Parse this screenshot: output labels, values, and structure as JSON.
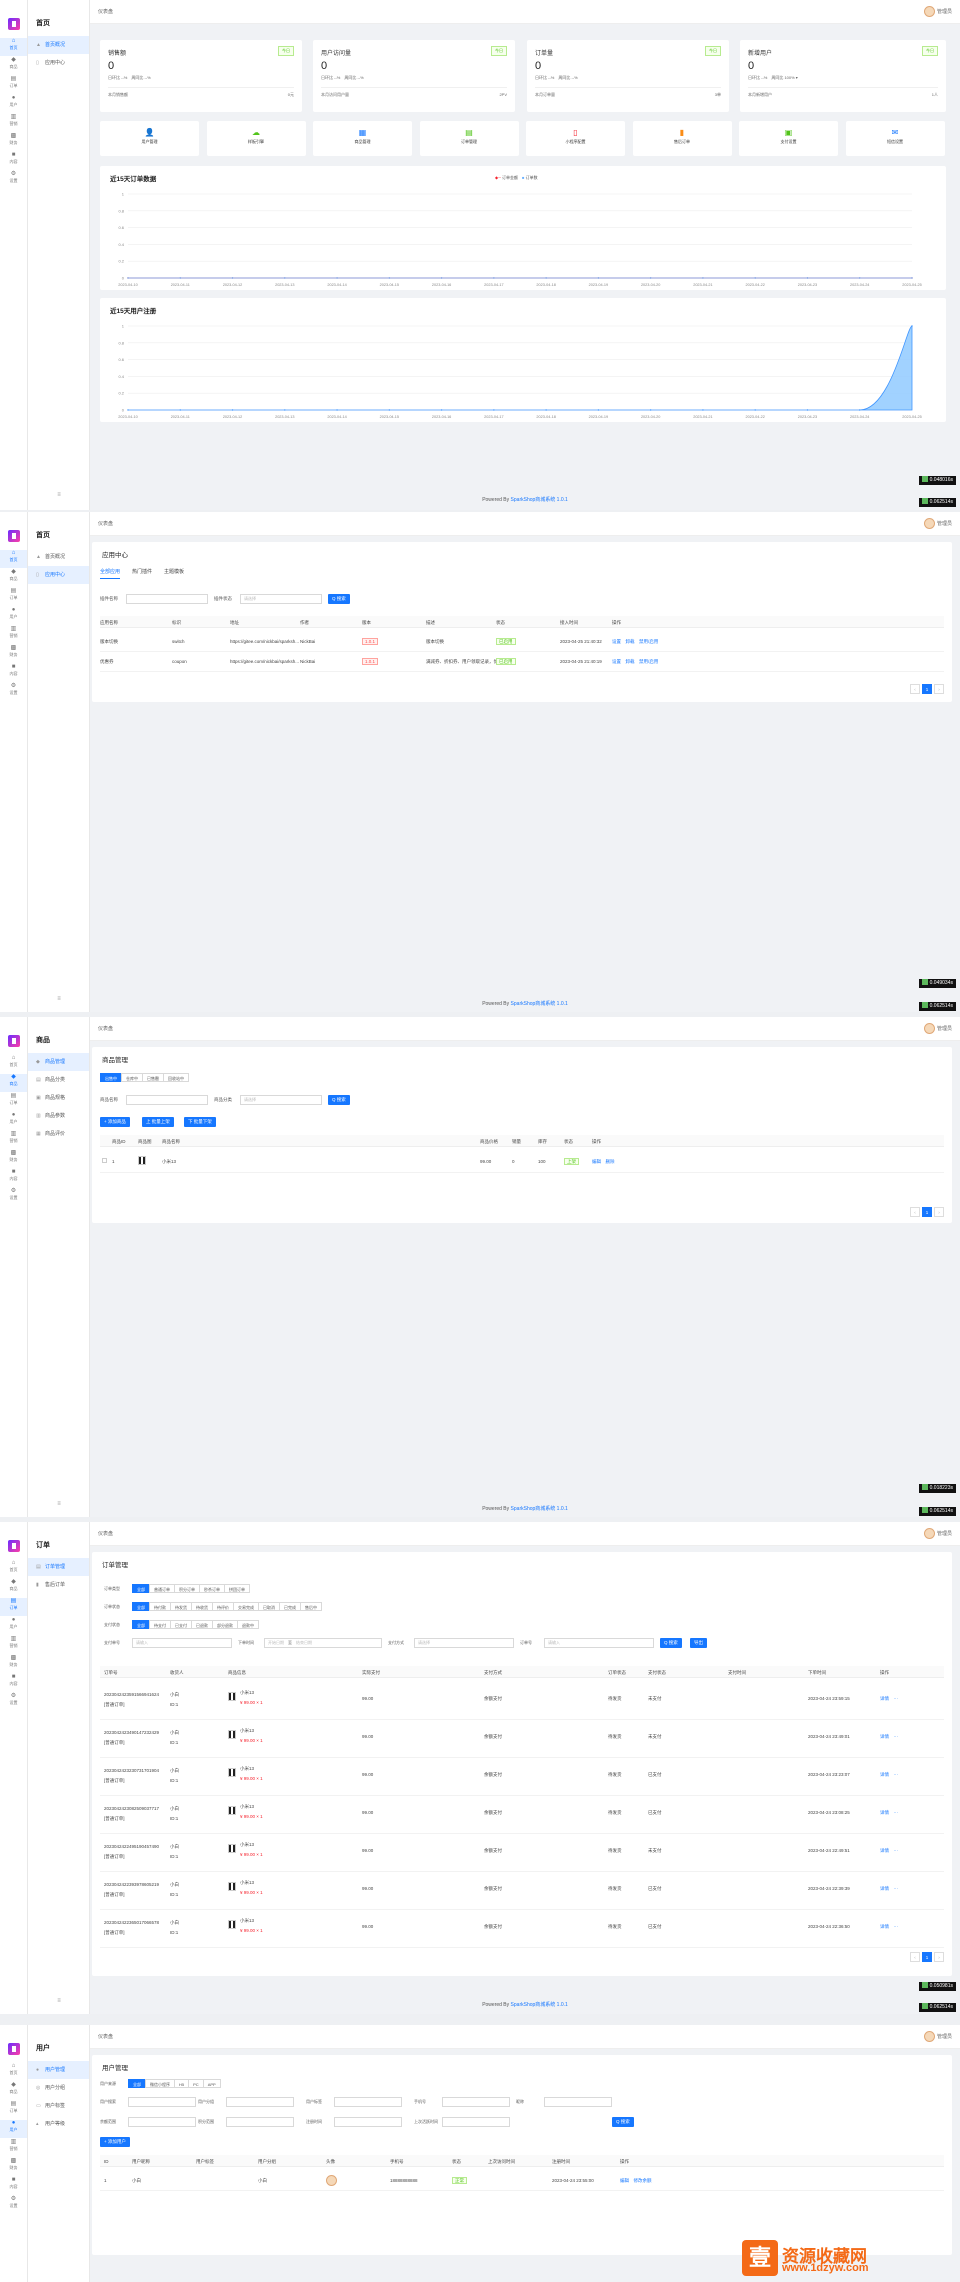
{
  "common": {
    "admin": "管理员",
    "breadcrumb": "仪表盘",
    "fold": "≡",
    "footer_prefix": "Powered By ",
    "footer_link": "SparkShop商城系统 1.0.1",
    "rail": [
      {
        "icon": "⌂",
        "label": "首页"
      },
      {
        "icon": "◆",
        "label": "商品"
      },
      {
        "icon": "▤",
        "label": "订单"
      },
      {
        "icon": "●",
        "label": "用户"
      },
      {
        "icon": "▥",
        "label": "营销"
      },
      {
        "icon": "▩",
        "label": "财务"
      },
      {
        "icon": "■",
        "label": "内容"
      },
      {
        "icon": "⚙",
        "label": "设置"
      }
    ]
  },
  "s1": {
    "sub_title": "首页",
    "menu": [
      "首页概况",
      "应用中心"
    ],
    "stats": [
      {
        "title": "销售额",
        "tag": "今日",
        "value": "0",
        "cmp": "日环比 --%　周同比 --%",
        "foot": "本月销售额",
        "foot_val": "0元"
      },
      {
        "title": "用户访问量",
        "tag": "今日",
        "value": "0",
        "cmp": "日环比 --%　周同比 --%",
        "foot": "本月访问用户量",
        "foot_val": "2PV"
      },
      {
        "title": "订单量",
        "tag": "今日",
        "value": "0",
        "cmp": "日环比 --%　周同比 --%",
        "foot": "本月订单量",
        "foot_val": "3单"
      },
      {
        "title": "新增用户",
        "tag": "今日",
        "value": "0",
        "cmp": "日环比 --%　周同比 100% ▾",
        "foot": "本月新增用户",
        "foot_val": "1人"
      }
    ],
    "quick": [
      {
        "icon": "👤",
        "label": "用户管理",
        "color": "#1677ff"
      },
      {
        "icon": "☁",
        "label": "样板引擎",
        "color": "#52c41a"
      },
      {
        "icon": "▦",
        "label": "商品管理",
        "color": "#1677ff"
      },
      {
        "icon": "▤",
        "label": "订单管理",
        "color": "#52c41a"
      },
      {
        "icon": "▯",
        "label": "小程序配置",
        "color": "#f5222d"
      },
      {
        "icon": "▮",
        "label": "售后订单",
        "color": "#fa8c16"
      },
      {
        "icon": "▣",
        "label": "支付设置",
        "color": "#52c41a"
      },
      {
        "icon": "✉",
        "label": "短信设置",
        "color": "#1677ff"
      }
    ],
    "chart_data": [
      {
        "type": "line",
        "title": "近15天订单数据",
        "legend": [
          "订单金额",
          "订单数"
        ],
        "series": [
          {
            "name": "订单金额",
            "values": [
              0,
              0,
              0,
              0,
              0,
              0,
              0,
              0,
              0,
              0,
              0,
              0,
              0,
              0,
              0,
              0
            ]
          },
          {
            "name": "订单数",
            "values": [
              0,
              0,
              0,
              0,
              0,
              0,
              0,
              0,
              0,
              0,
              0,
              0,
              0,
              0,
              0,
              0
            ]
          }
        ],
        "x": [
          "2023-04-10",
          "2023-04-11",
          "2023-04-12",
          "2023-04-13",
          "2023-04-14",
          "2023-04-15",
          "2023-04-16",
          "2023-04-17",
          "2023-04-18",
          "2023-04-19",
          "2023-04-20",
          "2023-04-21",
          "2023-04-22",
          "2023-04-23",
          "2023-04-24",
          "2023-04-25"
        ],
        "yticks": [
          "1",
          "0.8",
          "0.6",
          "0.4",
          "0.2",
          "0"
        ],
        "ylim": [
          0,
          1
        ]
      },
      {
        "type": "area",
        "title": "近15天用户注册",
        "series": [
          {
            "values": [
              0,
              0,
              0,
              0,
              0,
              0,
              0,
              0,
              0,
              0,
              0,
              0,
              0,
              0,
              0,
              1
            ]
          }
        ],
        "x": [
          "2023-04-10",
          "2023-04-11",
          "2023-04-12",
          "2023-04-13",
          "2023-04-14",
          "2023-04-15",
          "2023-04-16",
          "2023-04-17",
          "2023-04-18",
          "2023-04-19",
          "2023-04-20",
          "2023-04-21",
          "2023-04-22",
          "2023-04-23",
          "2023-04-24",
          "2023-04-25"
        ],
        "yticks": [
          "1",
          "0.8",
          "0.6",
          "0.4",
          "0.2",
          "0"
        ],
        "ylim": [
          0,
          1
        ]
      }
    ],
    "badges": [
      "0.048016s",
      "0.062514s"
    ]
  },
  "s2": {
    "sub_title": "首页",
    "menu": [
      "首页概况",
      "应用中心"
    ],
    "card_title": "应用中心",
    "tabs": [
      "全部应用",
      "热门插件",
      "主题模板"
    ],
    "f1": "插件名称",
    "f1ph": "",
    "f2": "插件状态",
    "f2ph": "请选择",
    "search": "Q 搜索",
    "heads": [
      "应用名称",
      "标识",
      "地址",
      "作者",
      "版本",
      "描述",
      "状态",
      "接入时间",
      "操作"
    ],
    "rows": [
      [
        "版本切换",
        "switch",
        "https://gitee.com/nickbai/sparksh...",
        "NickBai",
        "1.0.1",
        "版本切换",
        "已启用",
        "2023-04-25 21:40:32",
        "设置　卸载　禁用/启用"
      ],
      [
        "优惠券",
        "coupon",
        "https://gitee.com/nickbai/sparksh...",
        "NickBai",
        "1.0.1",
        "满减券、折扣券、用户领取记录，优...",
        "已启用",
        "2023-04-25 21:40:19",
        "设置　卸载　禁用/启用"
      ]
    ],
    "badges": [
      "0.049034s",
      "0.062514s"
    ]
  },
  "s3": {
    "sub_title": "商品",
    "menu": [
      "商品管理",
      "商品分类",
      "商品规格",
      "商品参数",
      "商品评价"
    ],
    "card_title": "商品管理",
    "filters": [
      "出售中",
      "仓库中",
      "已售罄",
      "回收站中"
    ],
    "f1": "商品名称",
    "f2": "商品分类",
    "f2ph": "请选择",
    "search": "Q 搜索",
    "add": "+ 添加商品",
    "b2": "上 批量上架",
    "b3": "下 批量下架",
    "heads": [
      "商品ID",
      "商品图",
      "商品名称",
      "商品价格",
      "销量",
      "库存",
      "状态",
      "操作"
    ],
    "row": [
      "1",
      "",
      "小米13",
      "99.00",
      "0",
      "100",
      "上架",
      "编辑　删除"
    ],
    "badges": [
      "0.018223s",
      "0.062514s"
    ]
  },
  "s4": {
    "sub_title": "订单",
    "menu": [
      "订单管理",
      "售后订单"
    ],
    "card_title": "订单管理",
    "r1label": "订单类型",
    "r1": [
      "全部",
      "普通订单",
      "积分订单",
      "秒杀订单",
      "拼团订单"
    ],
    "r2label": "订单状态",
    "r2": [
      "全部",
      "待付款",
      "待发货",
      "待收货",
      "待评价",
      "交易完成",
      "已取消",
      "已完成",
      "售后中"
    ],
    "r3label": "支付状态",
    "r3": [
      "全部",
      "待支付",
      "已支付",
      "已退款",
      "部分退款",
      "退款中"
    ],
    "q1": "支付单号",
    "q1ph": "请输入",
    "q2": "下单时间",
    "q2ph": "开始日期",
    "q2to": "至",
    "q2ph2": "结束日期",
    "q3": "支付方式",
    "q3ph": "请选择",
    "q4": "订单号",
    "q4ph": "请输入",
    "search": "Q 搜索",
    "export": "导出",
    "heads": [
      "订单号",
      "收货人",
      "商品信息",
      "实际支付",
      "支付方式",
      "订单状态",
      "支付状态",
      "支付时间",
      "下单时间",
      "操作"
    ],
    "orders": [
      {
        "no": "2023042423591566941624",
        "type": "[普通订单]",
        "user": "小白",
        "uid": "ID:1",
        "item": "小米13",
        "price": "¥ 99.00 × 1",
        "pay": "99.00",
        "method": "余额支付",
        "status": "待发货",
        "pstat": "未支付",
        "time": "2023-04-24 23:59:15",
        "op": "详情　···"
      },
      {
        "no": "2023042423490147232429",
        "type": "[普通订单]",
        "user": "小白",
        "uid": "ID:1",
        "item": "小米13",
        "price": "¥ 99.00 × 1",
        "pay": "99.00",
        "method": "余额支付",
        "status": "待发货",
        "pstat": "未支付",
        "time": "2023-04-24 23:49:01",
        "op": "详情　···"
      },
      {
        "no": "2023042423230731701904",
        "type": "[普通订单]",
        "user": "小白",
        "uid": "ID:1",
        "item": "小米13",
        "price": "¥ 99.00 × 1",
        "pay": "99.00",
        "method": "余额支付",
        "status": "待发货",
        "pstat": "已支付",
        "time": "2023-04-24 23:23:07",
        "op": "详情　···"
      },
      {
        "no": "2023042423082509037717",
        "type": "[普通订单]",
        "user": "小白",
        "uid": "ID:1",
        "item": "小米13",
        "price": "¥ 99.00 × 1",
        "pay": "99.00",
        "method": "余额支付",
        "status": "待发货",
        "pstat": "已支付",
        "time": "2023-04-24 23:08:25",
        "op": "详情　···"
      },
      {
        "no": "2023042422495190457490",
        "type": "[普通订单]",
        "user": "小白",
        "uid": "ID:1",
        "item": "小米13",
        "price": "¥ 99.00 × 1",
        "pay": "99.00",
        "method": "余额支付",
        "status": "待发货",
        "pstat": "未支付",
        "time": "2023-04-24 22:49:51",
        "op": "详情　···"
      },
      {
        "no": "2023042422393978605219",
        "type": "[普通订单]",
        "user": "小白",
        "uid": "ID:1",
        "item": "小米13",
        "price": "¥ 99.00 × 1",
        "pay": "99.00",
        "method": "余额支付",
        "status": "待发货",
        "pstat": "已支付",
        "time": "2023-04-24 22:39:39",
        "op": "详情　···"
      },
      {
        "no": "2023042422365017066578",
        "type": "[普通订单]",
        "user": "小白",
        "uid": "ID:1",
        "item": "小米13",
        "price": "¥ 99.00 × 1",
        "pay": "99.00",
        "method": "余额支付",
        "status": "待发货",
        "pstat": "已支付",
        "time": "2023-04-24 22:36:50",
        "op": "详情　···"
      }
    ],
    "badges": [
      "0.050981s",
      "0.062514s"
    ]
  },
  "s5": {
    "sub_title": "用户",
    "menu": [
      "用户管理",
      "用户分组",
      "用户标签",
      "用户等级"
    ],
    "card_title": "用户管理",
    "r1label": "用户来源",
    "r1": [
      "全部",
      "微信小程序",
      "H5",
      "PC",
      "APP"
    ],
    "labels": [
      "用户搜索",
      "用户分组",
      "用户标签",
      "手机号",
      "昵称",
      "余额范围",
      "积分范围",
      "注册时间",
      "上次活跃时间"
    ],
    "add": "+ 添加用户",
    "search": "Q 搜索",
    "heads": [
      "ID",
      "用户昵称",
      "用户标签",
      "用户分组",
      "头像",
      "手机号",
      "状态",
      "上次访问时间",
      "注册时间",
      "操作"
    ],
    "row": [
      "1",
      "小白",
      "",
      "小白",
      "",
      "18888888888",
      "正常",
      "",
      "2023-04-24 23:55:00",
      "编辑　修改余额"
    ]
  },
  "watermark": {
    "mark": "壹",
    "cn": "资源收藏网",
    "url": "www.1dzyw.com"
  }
}
